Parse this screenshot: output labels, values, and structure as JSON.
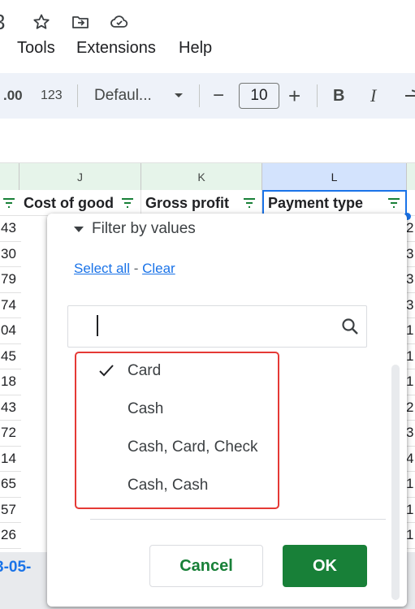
{
  "titlebar": {
    "partial_char": "3"
  },
  "menubar": {
    "items": [
      "Tools",
      "Extensions",
      "Help"
    ]
  },
  "toolbar": {
    "decimal_label": ".00",
    "number_format_label": "123",
    "font_name": "Defaul...",
    "font_size": "10",
    "minus": "−",
    "plus": "+",
    "bold": "B",
    "italic": "I"
  },
  "columns": [
    {
      "letter": "J",
      "header": "Cost of good"
    },
    {
      "letter": "K",
      "header": "Gross profit"
    },
    {
      "letter": "L",
      "header": "Payment type"
    }
  ],
  "left_numbers": [
    "43",
    "30",
    "79",
    "74",
    "04",
    "45",
    "18",
    "43",
    "72",
    "14",
    "65",
    "57",
    "26"
  ],
  "right_digits": [
    "2",
    "3",
    "3",
    "3",
    "1",
    "1",
    "1",
    "2",
    "3",
    "4",
    "1",
    "1",
    "1"
  ],
  "bottom_date": "3-05-",
  "filter": {
    "title": "Filter by values",
    "select_all": "Select all",
    "separator": " - ",
    "clear": "Clear",
    "search_placeholder": "",
    "values": [
      {
        "label": "Card",
        "checked": true
      },
      {
        "label": "Cash",
        "checked": false
      },
      {
        "label": "Cash, Card, Check",
        "checked": false
      },
      {
        "label": "Cash, Cash",
        "checked": false
      }
    ],
    "cancel_label": "Cancel",
    "ok_label": "OK"
  },
  "colors": {
    "accent": "#1a73e8",
    "ok_green": "#188038",
    "highlight_red": "#e53935"
  }
}
